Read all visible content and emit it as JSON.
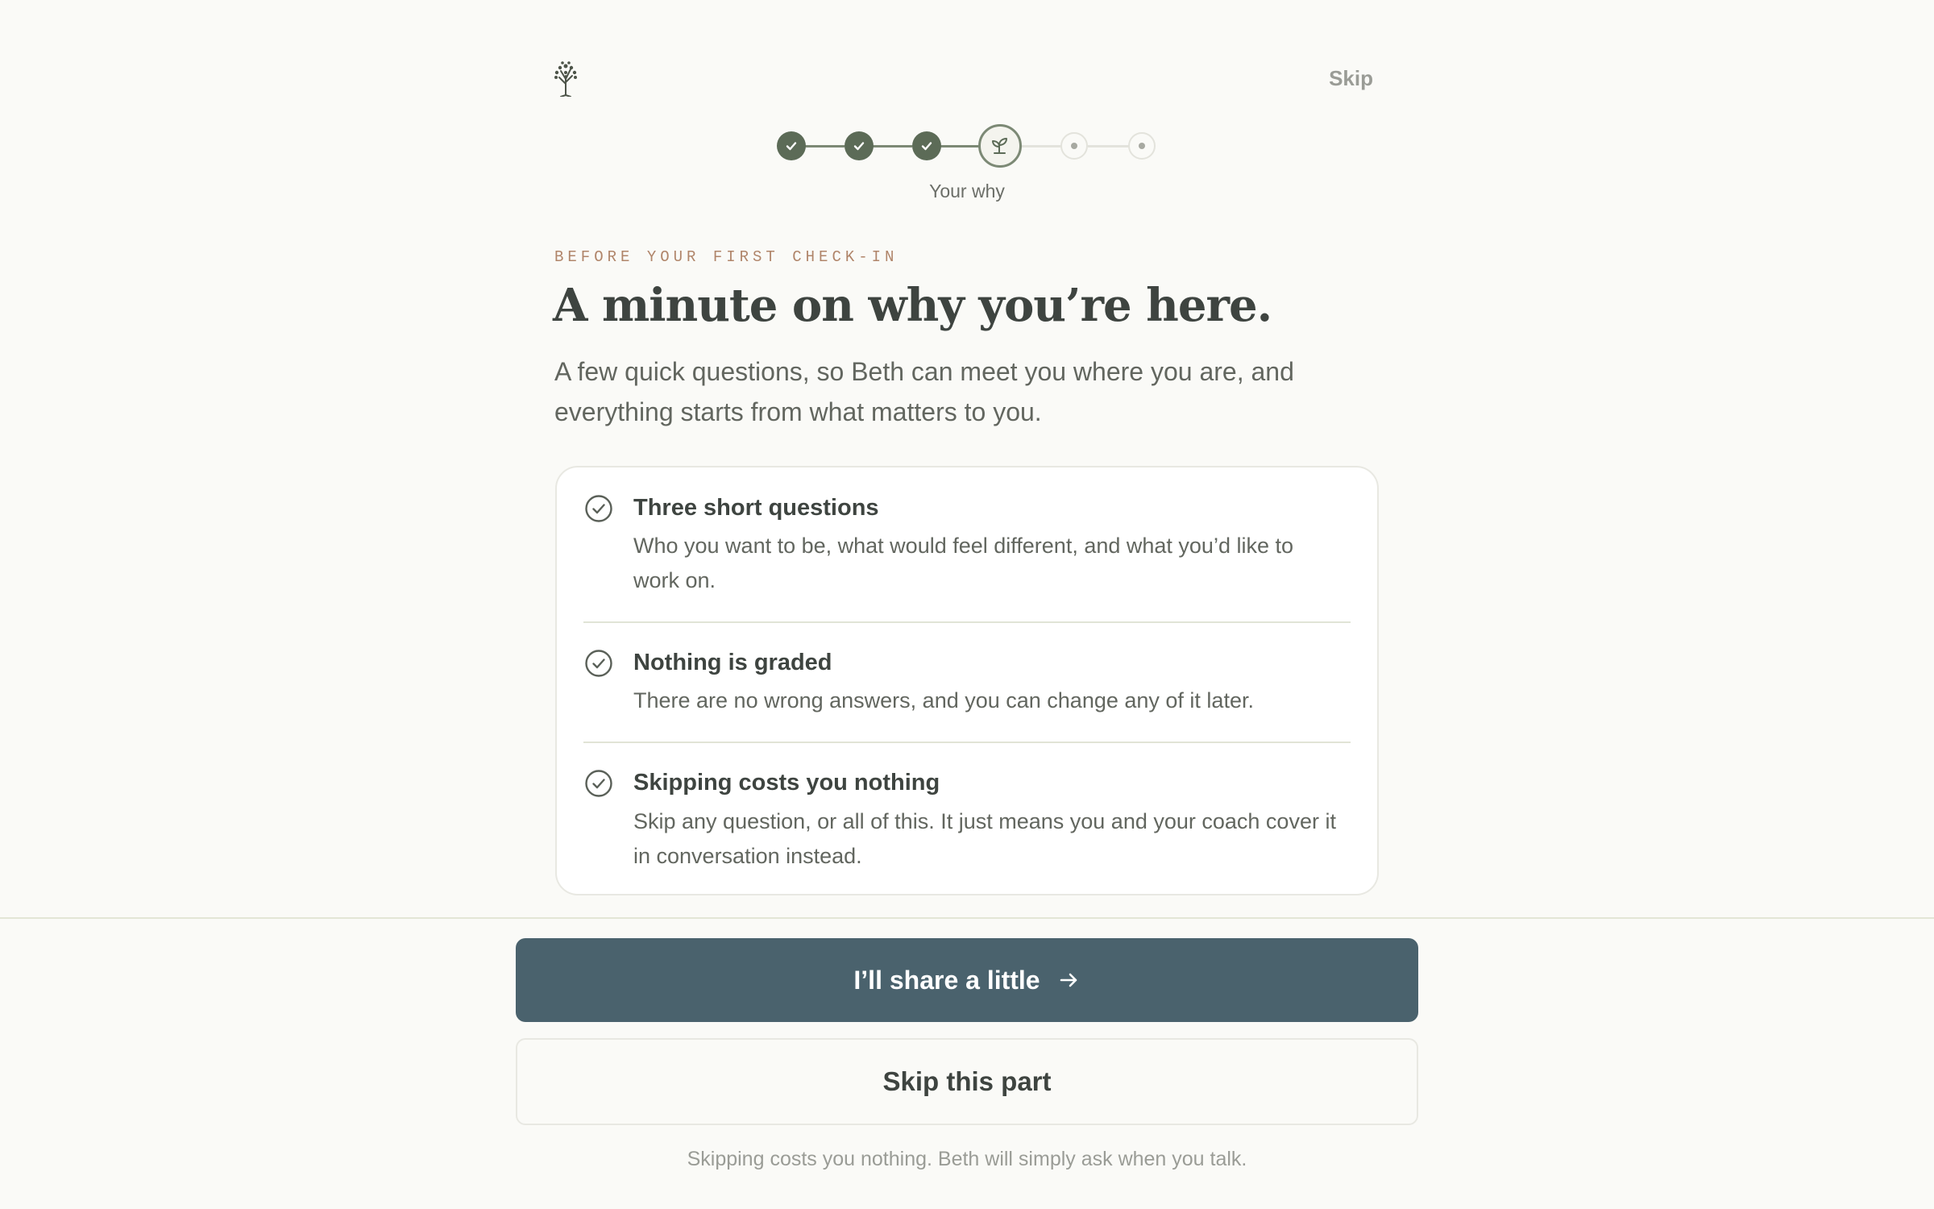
{
  "header": {
    "logo_icon": "tree-icon",
    "skip_label": "Skip"
  },
  "stepper": {
    "steps": [
      {
        "state": "done",
        "icon": "check-icon"
      },
      {
        "state": "done",
        "icon": "check-icon"
      },
      {
        "state": "done",
        "icon": "check-icon"
      },
      {
        "state": "current",
        "icon": "sprout-icon"
      },
      {
        "state": "todo",
        "icon": "dot-icon"
      },
      {
        "state": "todo",
        "icon": "dot-icon"
      }
    ],
    "current_caption": "Your why"
  },
  "intro": {
    "eyebrow": "BEFORE YOUR FIRST CHECK-IN",
    "title": "A minute on why you’re here.",
    "subtitle": "A few quick questions, so Beth can meet you where you are, and everything starts from what matters to you."
  },
  "card": {
    "items": [
      {
        "icon": "check-circle-icon",
        "title": "Three short questions",
        "text": "Who you want to be, what would feel different, and what you’d like to work on."
      },
      {
        "icon": "check-circle-icon",
        "title": "Nothing is graded",
        "text": "There are no wrong answers, and you can change any of it later."
      },
      {
        "icon": "check-circle-icon",
        "title": "Skipping costs you nothing",
        "text": "Skip any question, or all of this. It just means you and your coach cover it in conversation instead."
      }
    ]
  },
  "actions": {
    "primary_label": "I’ll share a little",
    "primary_icon": "arrow-right-icon",
    "secondary_label": "Skip this part",
    "footnote": "Skipping costs you nothing. Beth will simply ask when you talk."
  },
  "colors": {
    "background": "#fafaf7",
    "accent_green": "#5c6b57",
    "primary_button": "#4a626d",
    "eyebrow": "#b0856a"
  }
}
